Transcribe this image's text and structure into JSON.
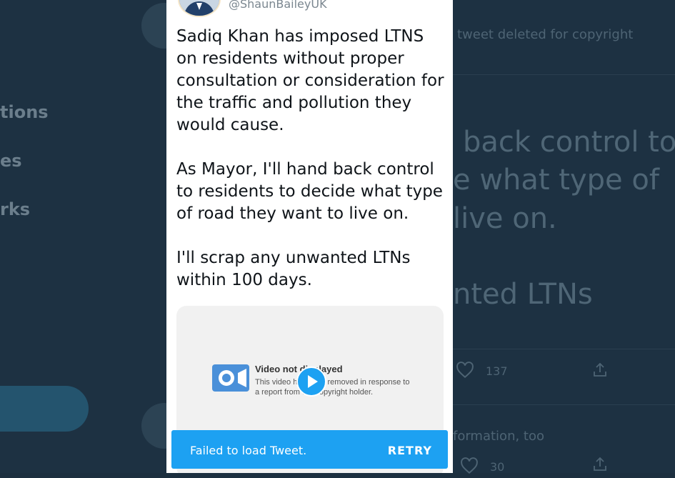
{
  "background": {
    "nav_items": [
      "tions",
      "es",
      "rks"
    ],
    "deleted_note": "tweet deleted for copyright",
    "big_lines": [
      "back control to",
      "e what type of",
      "live on.",
      "nted LTNs"
    ],
    "like_count_1": "137",
    "info_note": "formation, too",
    "like_count_2": "30"
  },
  "tweet": {
    "handle": "@ShaunBaileyUK",
    "paragraphs": [
      "Sadiq Khan has imposed LTNS on residents without proper consultation or consideration for the traffic and pollution they would cause.",
      "As Mayor, I'll hand back control to residents to decide what type of road they want to live on.",
      "I'll scrap any unwanted LTNs within 100 days."
    ],
    "media": {
      "title": "Video not displayed",
      "body": "This video has been removed in response to a report from the copyright holder."
    }
  },
  "toast": {
    "message": "Failed to load Tweet.",
    "action": "RETRY"
  },
  "colors": {
    "accent": "#1da1f2",
    "backdrop": "#1d3142"
  },
  "icons": [
    "camera-icon",
    "play-icon",
    "heart-icon",
    "share-icon"
  ]
}
